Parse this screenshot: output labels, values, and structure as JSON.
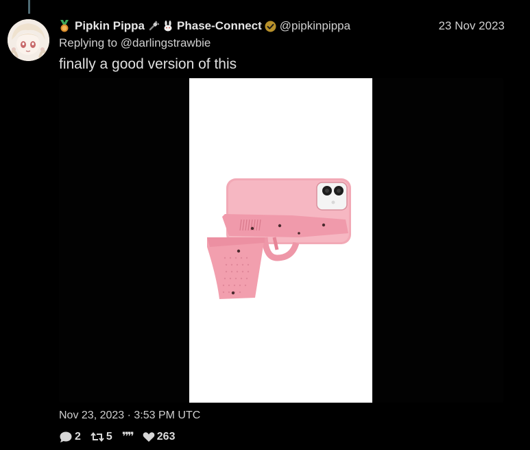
{
  "tweet": {
    "display_name": "Pipkin Pippa",
    "affiliation": "Phase-Connect",
    "handle": "@pipkinpippa",
    "date": "23 Nov 2023",
    "reply_prefix": "Replying to",
    "reply_to": "@darlingstrawbie",
    "text": "finally a good version of this",
    "timestamp": "Nov 23, 2023 · 3:53 PM UTC"
  },
  "icons": {
    "badge": "medal-icon",
    "name_emojis": [
      "plug-icon",
      "rabbit-icon"
    ],
    "verified": "verified-badge-icon",
    "verified_color": "#b8912b"
  },
  "stats": {
    "replies": "2",
    "retweets": "5",
    "quotes": "",
    "likes": "263"
  },
  "media": {
    "alt": "pink pistol-shaped phone case"
  }
}
